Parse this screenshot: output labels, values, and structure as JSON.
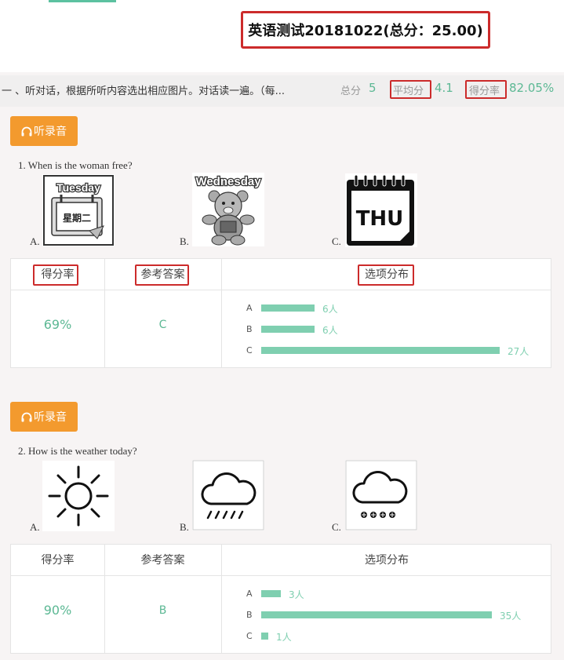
{
  "header": {
    "title": "英语测试20181022(总分：25.00)"
  },
  "section": {
    "title": "一 、听对话，根据所听内容选出相应图片。对话读一遍。（每...",
    "total_label": "总分",
    "total_value": "5",
    "avg_label": "平均分",
    "avg_value": "4.1",
    "rate_label": "得分率",
    "rate_value": "82.05%"
  },
  "questions": [
    {
      "listen_label": "听录音",
      "text": "1. When is the woman free?",
      "options": [
        {
          "letter": "A.",
          "calendar_top": "Tuesday",
          "calendar_main": "星期二"
        },
        {
          "letter": "B.",
          "image_text": "Wednesday"
        },
        {
          "letter": "C.",
          "image_text": "THU"
        }
      ],
      "table": {
        "headers": [
          "得分率",
          "参考答案",
          "选项分布"
        ],
        "rate": "69%",
        "answer": "C",
        "distribution": [
          {
            "option": "A",
            "count": 6,
            "label": "6人"
          },
          {
            "option": "B",
            "count": 6,
            "label": "6人"
          },
          {
            "option": "C",
            "count": 27,
            "label": "27人"
          }
        ]
      }
    },
    {
      "listen_label": "听录音",
      "text": "2. How is the weather today?",
      "options": [
        {
          "letter": "A.",
          "icon": "sun-icon"
        },
        {
          "letter": "B.",
          "icon": "rain-cloud-icon"
        },
        {
          "letter": "C.",
          "icon": "snow-cloud-icon"
        }
      ],
      "table": {
        "headers": [
          "得分率",
          "参考答案",
          "选项分布"
        ],
        "rate": "90%",
        "answer": "B",
        "distribution": [
          {
            "option": "A",
            "count": 3,
            "label": "3人"
          },
          {
            "option": "B",
            "count": 35,
            "label": "35人"
          },
          {
            "option": "C",
            "count": 1,
            "label": "1人"
          }
        ]
      }
    }
  ],
  "colors": {
    "accent_green": "#5cb894",
    "bar_green": "#7fcfb0",
    "button_orange": "#f39a2e",
    "highlight_red": "#cc2b2b"
  }
}
